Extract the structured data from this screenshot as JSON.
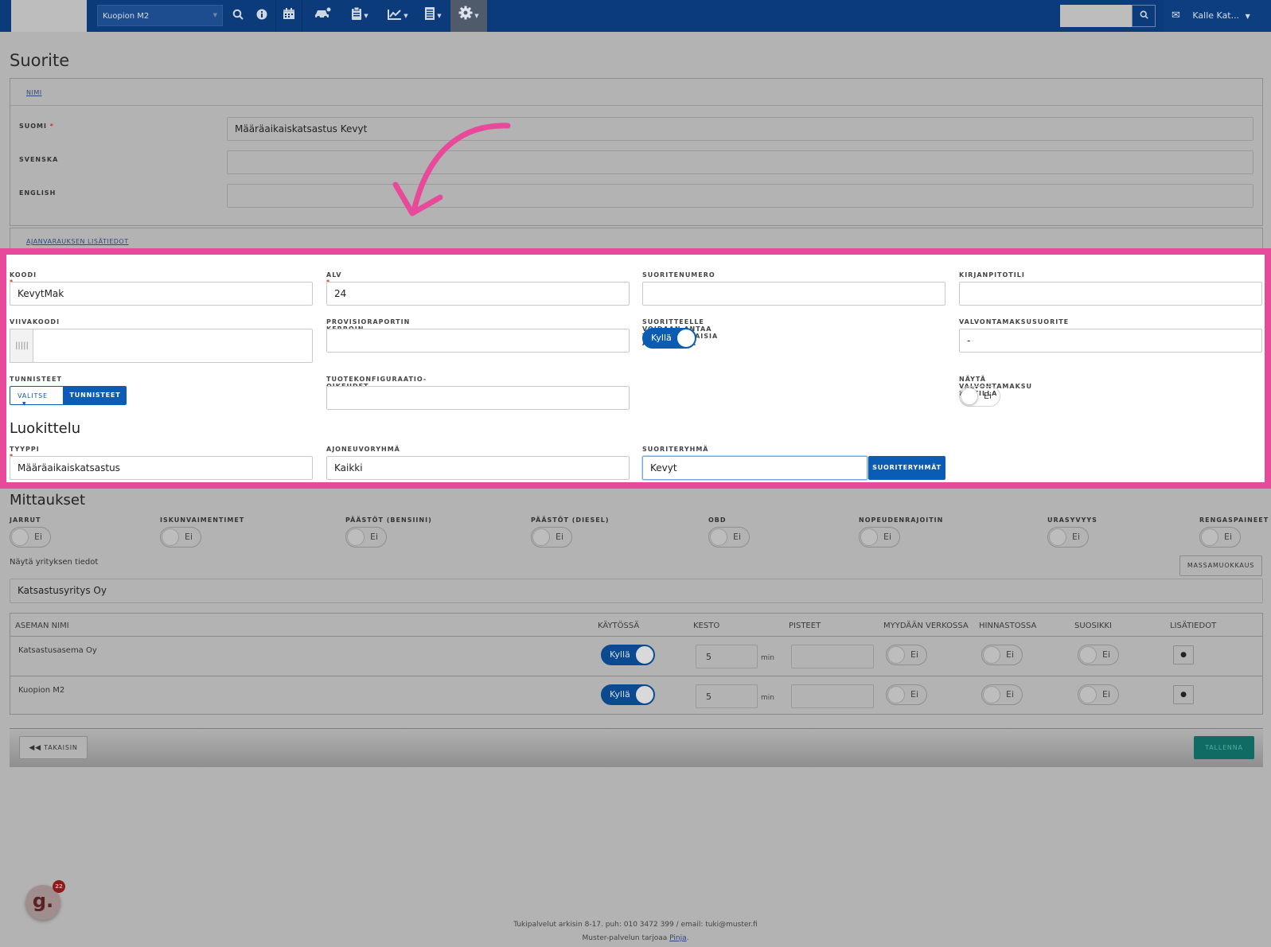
{
  "topbar": {
    "location": "Kuopion M2",
    "user": "Kalle Kat..."
  },
  "page": {
    "title": "Suorite"
  },
  "name_section": {
    "header": "NIMI",
    "fields": [
      {
        "label": "SUOMI",
        "required": "*",
        "value": "Määräaikaiskatsastus Kevyt"
      },
      {
        "label": "SVENSKA",
        "value": ""
      },
      {
        "label": "ENGLISH",
        "value": ""
      }
    ],
    "booking_header": "AJANVARAUKSEN LISÄTIEDOT"
  },
  "basic": {
    "koodi_label": "KOODI",
    "koodi_value": "KevytMak",
    "alv_label": "ALV",
    "alv_value": "24",
    "suoritenumero_label": "SUORITENUMERO",
    "suoritenumero_value": "",
    "kirjanpitotili_label": "KIRJANPITOTILI",
    "kirjanpitotili_value": "",
    "viivakoodi_label": "VIIVAKOODI",
    "provisio_label": "PROVISIORAPORTIN KERROIN",
    "provisio_value": "",
    "discount_label": "SUORITTEELLE VOIDAAN ANTAA YRITYSKOHTAISIA ALENNUKSIA",
    "discount_value": "Kyllä",
    "valvonta_label": "VALVONTAMAKSUSUORITE",
    "valvonta_value": "-",
    "tunnisteet_label": "TUNNISTEET",
    "valitse_label": "VALITSE",
    "tunnisteet_button": "TUNNISTEET",
    "tuotekonf_label": "TUOTEKONFIGURAATIO-OIKEUDET",
    "tuotekonf_value": "",
    "nayta_label": "NÄYTÄ VALVONTAMAKSU KUITILLA",
    "nayta_value": "Ei"
  },
  "classification": {
    "heading": "Luokittelu",
    "tyyppi_label": "TYYPPI",
    "tyyppi_value": "Määräaikaiskatsastus",
    "ajoneuvo_label": "AJONEUVORYHMÄ",
    "ajoneuvo_value": "Kaikki",
    "suoriteryhma_label": "SUORITERYHMÄ",
    "suoriteryhma_value": "Kevyt",
    "suoriteryhmat_button": "SUORITERYHMÄT"
  },
  "measurements": {
    "heading": "Mittaukset",
    "items": [
      {
        "label": "JARRUT",
        "value": "Ei"
      },
      {
        "label": "ISKUNVAIMENTIMET",
        "value": "Ei"
      },
      {
        "label": "PÄÄSTÖT (BENSIINI)",
        "value": "Ei"
      },
      {
        "label": "PÄÄSTÖT (DIESEL)",
        "value": "Ei"
      },
      {
        "label": "OBD",
        "value": "Ei"
      },
      {
        "label": "NOPEUDENRAJOITIN",
        "value": "Ei"
      },
      {
        "label": "URASYVYYS",
        "value": "Ei"
      },
      {
        "label": "RENGASPAINEET",
        "value": "Ei"
      }
    ],
    "company_label": "Näytä yrityksen tiedot",
    "mass_edit_button": "MASSAMUOKKAUS",
    "company_value": "Katsastusyritys Oy"
  },
  "stations_table": {
    "columns": [
      "ASEMAN NIMI",
      "KÄYTÖSSÄ",
      "KESTO",
      "PISTEET",
      "MYYDÄÄN VERKOSSA",
      "HINNASTOSSA",
      "SUOSIKKI",
      "LISÄTIEDOT"
    ],
    "unit": "min",
    "rows": [
      {
        "name": "Katsastusasema Oy",
        "enabled": "Kyllä",
        "duration": "5",
        "points": "",
        "online": "Ei",
        "pricelist": "Ei",
        "favorite": "Ei"
      },
      {
        "name": "Kuopion M2",
        "enabled": "Kyllä",
        "duration": "5",
        "points": "",
        "online": "Ei",
        "pricelist": "Ei",
        "favorite": "Ei"
      }
    ]
  },
  "actions": {
    "back": "TAKAISIN",
    "save": "TALLENNA"
  },
  "footer": {
    "line1": "Tukipalvelut arkisin 8-17. puh: 010 3472 399 / email: tuki@muster.fi",
    "line2_prefix": "Muster-palvelun tarjoaa ",
    "line2_link": "Pinja",
    "line2_suffix": "."
  },
  "badge": {
    "letter": "g.",
    "count": "22"
  },
  "colors": {
    "nav": "#0b3b7a",
    "highlight": "#e8499a",
    "primary": "#0b5cb5",
    "save": "#0f6b63"
  }
}
